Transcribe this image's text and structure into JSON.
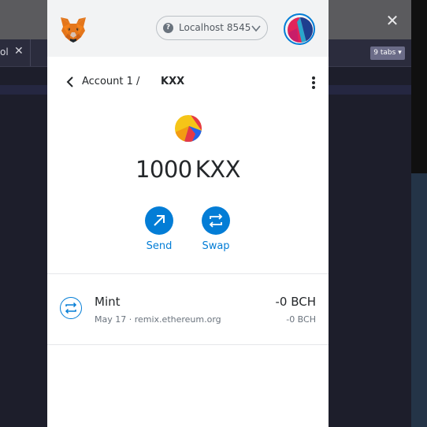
{
  "background": {
    "tab_label": "ol",
    "tabs_count_label": "9 tabs"
  },
  "header": {
    "network_label": "Localhost 8545"
  },
  "breadcrumb": {
    "account_label": "Account 1 /",
    "token_symbol": "KXX"
  },
  "balance": {
    "amount": "1000",
    "symbol": "KXX"
  },
  "actions": {
    "send_label": "Send",
    "swap_label": "Swap"
  },
  "transactions": [
    {
      "title": "Mint",
      "subtitle": "May 17 · remix.ethereum.org",
      "amount": "-0 BCH",
      "fiat": "-0 BCH"
    }
  ],
  "colors": {
    "accent": "#037dd6",
    "header_bg": "#f2f3f4",
    "text_primary": "#24272a",
    "text_secondary": "#6a737d"
  },
  "icons": [
    "metamask-fox-icon",
    "question-icon",
    "chevron-down-icon",
    "account-avatar-icon",
    "back-arrow-icon",
    "kebab-menu-icon",
    "token-icon",
    "send-arrow-icon",
    "swap-arrows-icon",
    "close-icon"
  ]
}
